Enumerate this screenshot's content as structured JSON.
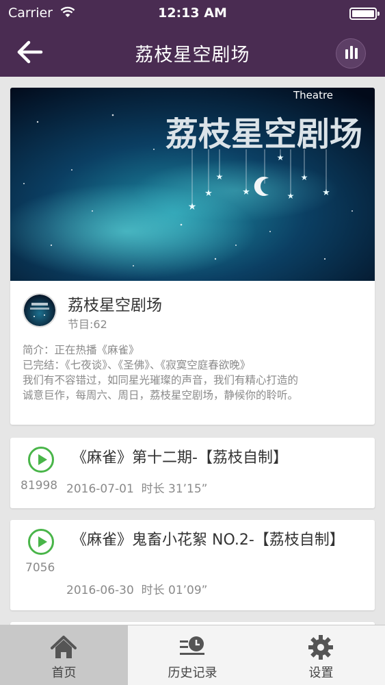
{
  "status_bar": {
    "carrier": "Carrier",
    "time": "12:13 AM"
  },
  "nav": {
    "title": "荔枝星空剧场",
    "back_icon": "back-arrow-icon",
    "player_icon": "audio-bars-icon"
  },
  "program": {
    "banner": {
      "title": "荔枝星空剧场",
      "subtitle": "Theatre"
    },
    "name": "荔枝星空剧场",
    "episode_count": "节目:62",
    "description": [
      "简介：正在热播《麻雀》",
      "已完结：《七夜谈》、《圣佛》、《寂寞空庭春欲晚》",
      "我们有不容错过，如同星光璀璨的声音，我们有精心打造的",
      "诚意巨作，每周六、周日，荔枝星空剧场，静候你的聆听。"
    ]
  },
  "episodes": [
    {
      "title": "《麻雀》第十二期-【荔枝自制】",
      "plays": "81998",
      "date": "2016-07-01",
      "duration": "时长 31’15”"
    },
    {
      "title": "《麻雀》鬼畜小花絮 NO.2-【荔枝自制】",
      "plays": "7056",
      "date": "2016-06-30",
      "duration": "时长 01’09”"
    }
  ],
  "tabs": [
    {
      "label": "首页",
      "icon": "home-icon",
      "active": true
    },
    {
      "label": "历史记录",
      "icon": "history-icon",
      "active": false
    },
    {
      "label": "设置",
      "icon": "gear-icon",
      "active": false
    }
  ],
  "colors": {
    "nav_bg": "#4a2c52",
    "play_green": "#49b549",
    "muted_text": "#8a8a8a"
  }
}
